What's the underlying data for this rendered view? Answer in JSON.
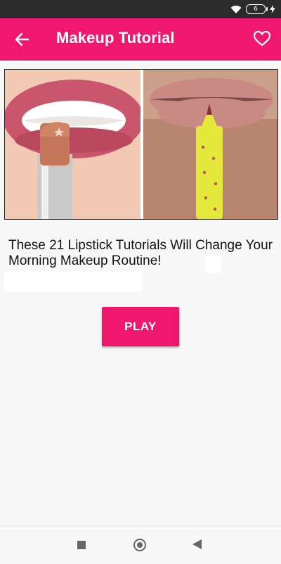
{
  "status_bar": {
    "battery_level": "6",
    "icons": [
      "wifi-icon",
      "battery-icon",
      "charging-bolt-icon"
    ]
  },
  "app_bar": {
    "title": "Makeup Tutorial",
    "back_icon": "arrow-left-icon",
    "favorite_icon": "heart-outline-icon"
  },
  "content": {
    "headline": "These 21 Lipstick Tutorials Will Change Your Morning Makeup Routine!",
    "play_label": "PLAY"
  },
  "nav_bar": {
    "icons": [
      "recents-square-icon",
      "home-circle-icon",
      "back-triangle-icon"
    ]
  },
  "colors": {
    "accent": "#f0176f",
    "status_bar": "#2b2b2b",
    "background": "#f7f7f7"
  }
}
